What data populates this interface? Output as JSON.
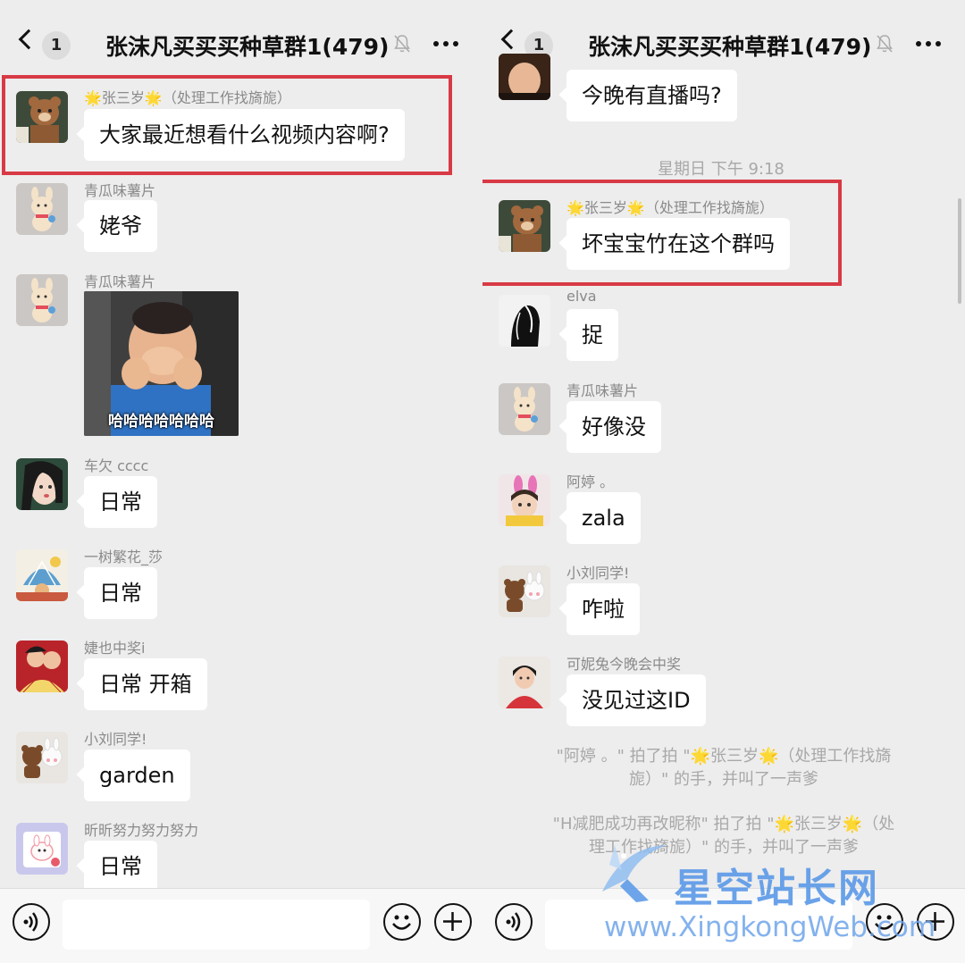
{
  "header": {
    "title": "张沫凡买买买种草群1(479)",
    "unread_count": "1"
  },
  "left": {
    "messages": [
      {
        "sender": "🌟张三岁🌟（处理工作找旖旎）",
        "text": "大家最近想看什么视频内容啊?"
      },
      {
        "sender": "青瓜味薯片",
        "text": "姥爷"
      },
      {
        "sender": "青瓜味薯片",
        "sticker_caption": "哈哈哈哈哈哈哈"
      },
      {
        "sender": "车欠 cccc",
        "text": "日常"
      },
      {
        "sender": "一树繁花_莎",
        "text": "日常"
      },
      {
        "sender": "婕也中奖i",
        "text": "日常  开箱"
      },
      {
        "sender": "小刘同学!",
        "text": "garden"
      },
      {
        "sender": "昕昕努力努力努力",
        "text": "日常"
      }
    ]
  },
  "right": {
    "top_partial_text": "今晚有直播吗?",
    "time_divider": "星期日 下午 9:18",
    "messages": [
      {
        "sender": "🌟张三岁🌟（处理工作找旖旎）",
        "text": "坏宝宝竹在这个群吗"
      },
      {
        "sender": "elva",
        "text": "捉"
      },
      {
        "sender": "青瓜味薯片",
        "text": "好像没"
      },
      {
        "sender": "阿婷    。",
        "text": "zala"
      },
      {
        "sender": "小刘同学!",
        "text": "咋啦"
      },
      {
        "sender": "可妮兔今晚会中奖",
        "text": "没见过这ID"
      }
    ],
    "system_messages": [
      {
        "line1": "\"阿婷    。\" 拍了拍 \"🌟张三岁🌟（处理工作找旖",
        "line2": "旎）\" 的手，并叫了一声爹"
      },
      {
        "line1": "\"H减肥成功再改昵称\" 拍了拍 \"🌟张三岁🌟（处",
        "line2": "理工作找旖旎）\" 的手，并叫了一声爹"
      }
    ]
  },
  "watermark": {
    "title": "星空站长网",
    "url": "www.XingkongWeb.com"
  },
  "colors": {
    "highlight": "#d83a45",
    "chat_background": "#ededed",
    "bubble": "#ffffff",
    "watermark": "#5e9be8"
  },
  "icons": [
    "back-chevron-icon",
    "mute-bell-icon",
    "more-icon",
    "voice-icon",
    "emoji-icon",
    "plus-icon"
  ]
}
